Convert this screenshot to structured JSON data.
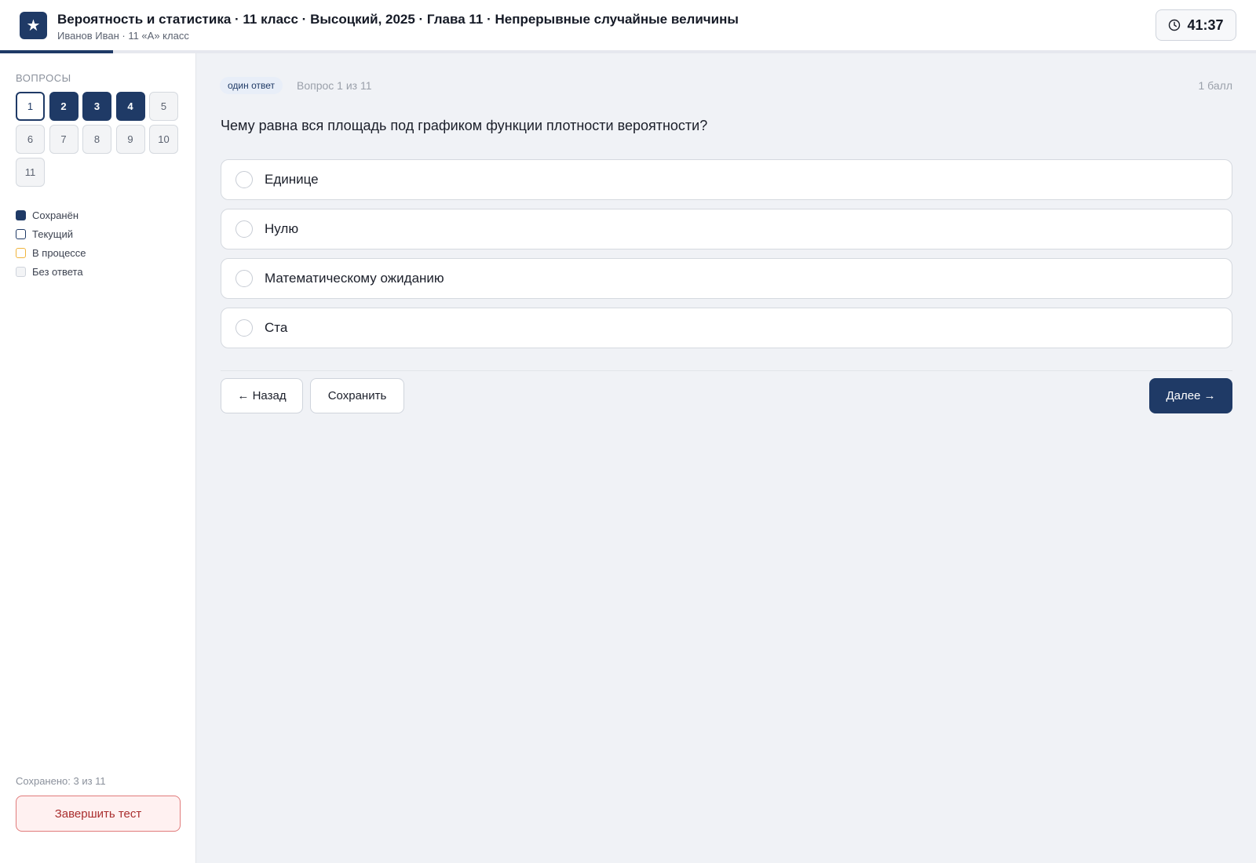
{
  "header": {
    "logo_icon": "star-icon",
    "logo_glyph": "★",
    "title": "Вероятность и статистика · 11 класс · Высоцкий, 2025 · Глава 11 · Непрерывные случайные величины",
    "subtitle": "Иванов Иван · 11 «А» класс",
    "timer": "41:37",
    "progress_fraction": 0.09
  },
  "sidebar": {
    "heading": "ВОПРОСЫ",
    "questions": [
      {
        "label": "1",
        "state": "current"
      },
      {
        "label": "2",
        "state": "saved"
      },
      {
        "label": "3",
        "state": "saved"
      },
      {
        "label": "4",
        "state": "saved"
      },
      {
        "label": "5",
        "state": "empty"
      },
      {
        "label": "6",
        "state": "empty"
      },
      {
        "label": "7",
        "state": "empty"
      },
      {
        "label": "8",
        "state": "empty"
      },
      {
        "label": "9",
        "state": "empty"
      },
      {
        "label": "10",
        "state": "empty"
      },
      {
        "label": "11",
        "state": "empty"
      }
    ],
    "legend": {
      "saved": "Сохранён",
      "current": "Текущий",
      "in_progress": "В процессе",
      "no_answer": "Без ответа"
    },
    "saved_count": "Сохранено: 3 из 11",
    "finish_label": "Завершить тест"
  },
  "main": {
    "badge": "один ответ",
    "counter": "Вопрос 1 из 11",
    "points": "1 балл",
    "question": "Чему равна вся площадь под графиком функции плотности вероятности?",
    "options": [
      {
        "label": "Единице"
      },
      {
        "label": "Нулю"
      },
      {
        "label": "Математическому ожиданию"
      },
      {
        "label": "Ста"
      }
    ],
    "back_label": "← Назад",
    "save_label": "Сохранить",
    "next_label": "Далее →"
  },
  "colors": {
    "accent": "#1f3a66",
    "in_progress": "#f0b43c",
    "danger": "#a92e2e"
  }
}
